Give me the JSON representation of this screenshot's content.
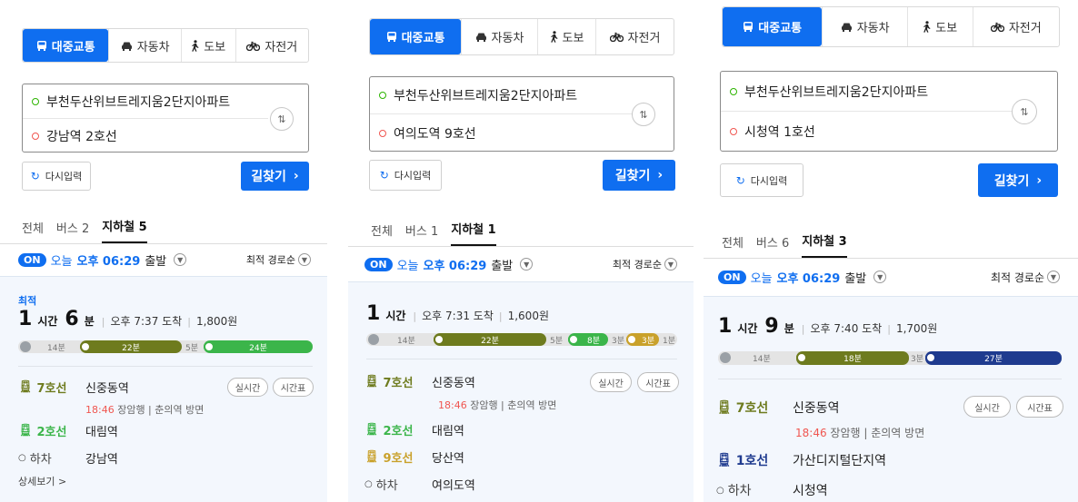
{
  "modes": [
    {
      "label": "대중교통",
      "icon": "bus-icon"
    },
    {
      "label": "자동차",
      "icon": "car-icon"
    },
    {
      "label": "도보",
      "icon": "walk-icon"
    },
    {
      "label": "자전거",
      "icon": "bike-icon"
    }
  ],
  "reset_label": "다시입력",
  "search_label": "길찾기",
  "search_arrow": "›",
  "origin": "부천두산위브트레지움2단지아파트",
  "tab_all": "전체",
  "depart": {
    "on": "ON",
    "today": "오늘",
    "time": "오후 06:29",
    "suffix": "출발"
  },
  "sort_label": "최적 경로순",
  "realtime_label": "실시간",
  "timetable_label": "시간표",
  "alight_label": "하차",
  "panels": [
    {
      "destination": "강남역 2호선",
      "tab_bus": "버스 2",
      "tab_subway": "지하철 5",
      "best_label": "최적",
      "hours": "1",
      "hour_unit": "시간",
      "minutes": "6",
      "minute_unit": "분",
      "arrival": "오후 7:37 도착",
      "fare": "1,800원",
      "segments": {
        "walk": "14분",
        "s1": "22분",
        "mid": "5분",
        "s2": "24분"
      },
      "leg1": {
        "line": "7호선",
        "station": "신중동역",
        "time": "18:46",
        "direction": "장암행 | 춘의역 방면",
        "color": "#6e7b1e"
      },
      "leg2": {
        "line": "2호선",
        "station": "대림역",
        "color": "#3bb54a"
      },
      "final_station": "강남역",
      "more_label": "상세보기 >"
    },
    {
      "destination": "여의도역 9호선",
      "tab_bus": "버스 1",
      "tab_subway": "지하철 1",
      "hours": "1",
      "hour_unit": "시간",
      "arrival": "오후 7:31 도착",
      "fare": "1,600원",
      "segments": {
        "walk": "14분",
        "s1": "22분",
        "mid": "5분",
        "s2": "8분",
        "mid2": "3분",
        "s3": "3분",
        "tail": "1분"
      },
      "leg1": {
        "line": "7호선",
        "station": "신중동역",
        "time": "18:46",
        "direction": "장암행 | 춘의역 방면",
        "color": "#6e7b1e"
      },
      "leg2": {
        "line": "2호선",
        "station": "대림역",
        "color": "#3bb54a"
      },
      "leg3": {
        "line": "9호선",
        "station": "당산역",
        "color": "#c9a12b"
      },
      "final_station": "여의도역"
    },
    {
      "destination": "시청역 1호선",
      "tab_bus": "버스 6",
      "tab_subway": "지하철 3",
      "hours": "1",
      "hour_unit": "시간",
      "minutes": "9",
      "minute_unit": "분",
      "arrival": "오후 7:40 도착",
      "fare": "1,700원",
      "segments": {
        "walk": "14분",
        "s1": "18분",
        "mid": "3분",
        "s2": "27분"
      },
      "leg1": {
        "line": "7호선",
        "station": "신중동역",
        "time": "18:46",
        "direction": "장암행 | 춘의역 방면",
        "color": "#6e7b1e"
      },
      "leg2": {
        "line": "1호선",
        "station": "가산디지털단지역",
        "color": "#1f3b8f"
      },
      "final_station": "시청역"
    }
  ],
  "colors": {
    "accent": "#0f6ef0",
    "line7": "#6e7b1e",
    "line2": "#3bb54a",
    "line9": "#c9a12b",
    "line1": "#1f3b8f",
    "time_red": "#f05650"
  }
}
